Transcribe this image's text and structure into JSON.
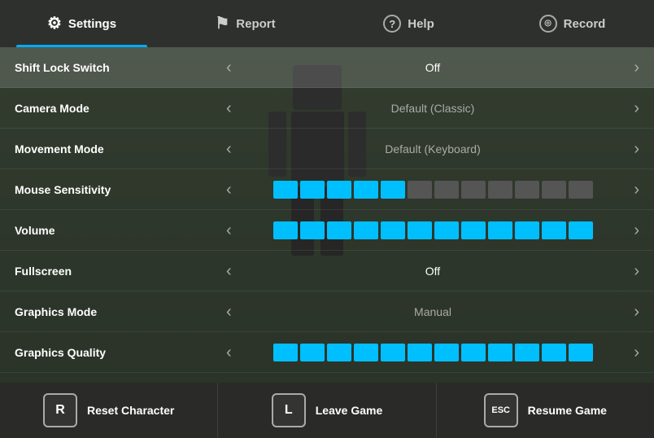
{
  "nav": {
    "tabs": [
      {
        "id": "settings",
        "label": "Settings",
        "icon": "⚙",
        "active": true
      },
      {
        "id": "report",
        "label": "Report",
        "icon": "⚑",
        "active": false
      },
      {
        "id": "help",
        "label": "Help",
        "icon": "?",
        "active": false
      },
      {
        "id": "record",
        "label": "Record",
        "icon": "◎",
        "active": false
      }
    ]
  },
  "settings": {
    "rows": [
      {
        "id": "shift-lock",
        "label": "Shift Lock Switch",
        "type": "toggle",
        "value": "Off",
        "highlight": true
      },
      {
        "id": "camera-mode",
        "label": "Camera Mode",
        "type": "toggle",
        "value": "Default (Classic)",
        "highlight": false
      },
      {
        "id": "movement-mode",
        "label": "Movement Mode",
        "type": "toggle",
        "value": "Default (Keyboard)",
        "highlight": false
      },
      {
        "id": "mouse-sensitivity",
        "label": "Mouse Sensitivity",
        "type": "slider",
        "filled": 5,
        "total": 12,
        "highlight": false
      },
      {
        "id": "volume",
        "label": "Volume",
        "type": "slider",
        "filled": 12,
        "total": 12,
        "highlight": false
      },
      {
        "id": "fullscreen",
        "label": "Fullscreen",
        "type": "toggle",
        "value": "Off",
        "highlight": false
      },
      {
        "id": "graphics-mode",
        "label": "Graphics Mode",
        "type": "toggle",
        "value": "Manual",
        "highlight": false
      },
      {
        "id": "graphics-quality",
        "label": "Graphics Quality",
        "type": "slider",
        "filled": 12,
        "total": 12,
        "highlight": false
      }
    ]
  },
  "bottom": {
    "actions": [
      {
        "id": "reset",
        "key": "R",
        "label": "Reset Character"
      },
      {
        "id": "leave",
        "key": "L",
        "label": "Leave Game"
      },
      {
        "id": "resume",
        "key": "ESC",
        "label": "Resume Game"
      }
    ]
  },
  "icons": {
    "settings": "⚙",
    "report": "⚑",
    "help": "?",
    "record": "◎",
    "arrow_left": "‹",
    "arrow_right": "›"
  }
}
